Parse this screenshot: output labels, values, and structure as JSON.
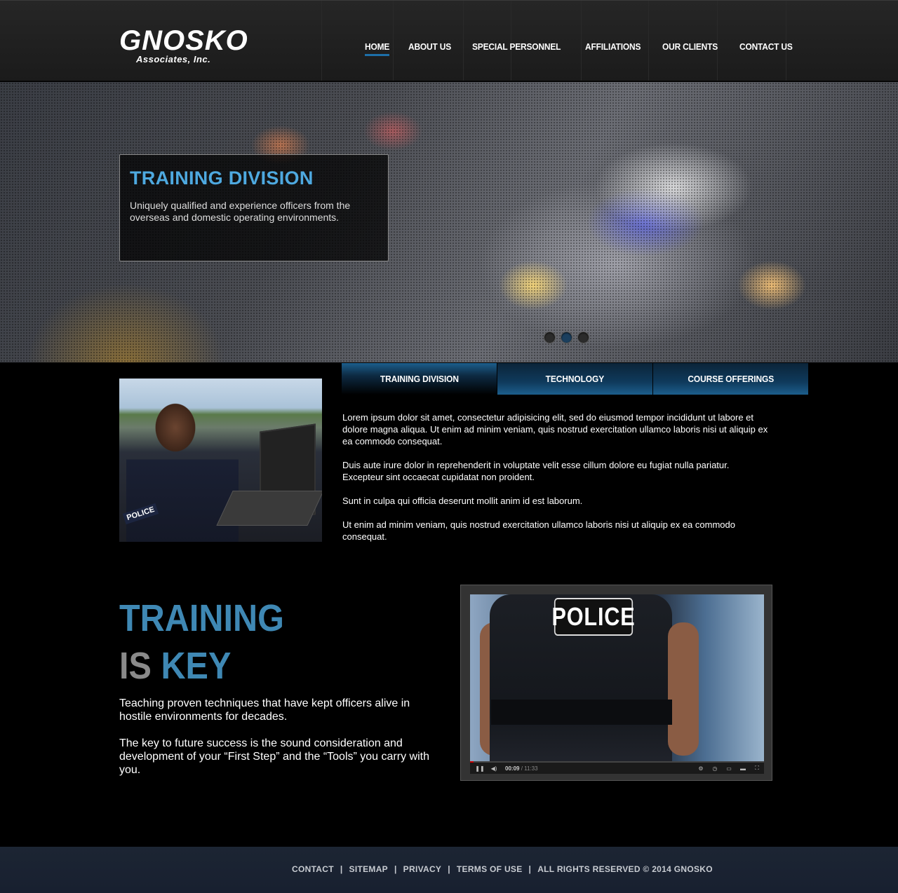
{
  "brand": {
    "name": "GNOSKO",
    "sub": "Associates, Inc."
  },
  "nav": [
    {
      "label": "HOME",
      "active": true
    },
    {
      "label": "ABOUT US"
    },
    {
      "label": "SPECIAL PERSONNEL"
    },
    {
      "label": "AFFILIATIONS"
    },
    {
      "label": "OUR CLIENTS"
    },
    {
      "label": "CONTACT US"
    }
  ],
  "hero": {
    "title": "TRAINING DIVISION",
    "text": "Uniquely qualified and experience officers from the overseas and domestic operating environments.",
    "slides": 3,
    "active_slide": 2
  },
  "photo": {
    "badge": "POLICE"
  },
  "tabs": [
    {
      "label": "TRAINING DIVISION",
      "active": true
    },
    {
      "label": "TECHNOLOGY"
    },
    {
      "label": "COURSE OFFERINGS"
    }
  ],
  "content": {
    "paragraphs": [
      "Lorem ipsum dolor sit amet, consectetur adipisicing elit, sed do eiusmod tempor incididunt ut labore et dolore magna aliqua. Ut enim ad minim veniam, quis nostrud exercitation ullamco laboris nisi ut aliquip ex ea commodo consequat.",
      "Duis aute irure dolor in reprehenderit in voluptate velit esse cillum dolore eu fugiat nulla pariatur. Excepteur sint occaecat cupidatat non proident.",
      "Sunt in culpa qui officia deserunt mollit anim id est laborum.",
      "Ut enim ad minim veniam, quis nostrud exercitation ullamco laboris nisi ut aliquip ex ea commodo consequat."
    ]
  },
  "feature": {
    "line1": "TRAINING",
    "line2a": "IS",
    "line2b": "KEY",
    "p1": "Teaching proven techniques that have kept officers alive in hostile environments for decades.",
    "p2": "The key to future success is the sound consideration and development of your “First Step” and the “Tools” you carry with you."
  },
  "video": {
    "patch": "POLICE",
    "current": "00:09",
    "duration": "/ 11:33",
    "progress": 0.013
  },
  "footer": {
    "links": [
      "CONTACT",
      "SITEMAP",
      "PRIVACY",
      "TERMS OF USE"
    ],
    "rights": "ALL RIGHTS RESERVED © 2014 GNOSKO",
    "separator": "|"
  },
  "colors": {
    "accent": "#3f88b4",
    "hero_title": "#4ea9e0",
    "footer_bg": "#1c2533"
  }
}
